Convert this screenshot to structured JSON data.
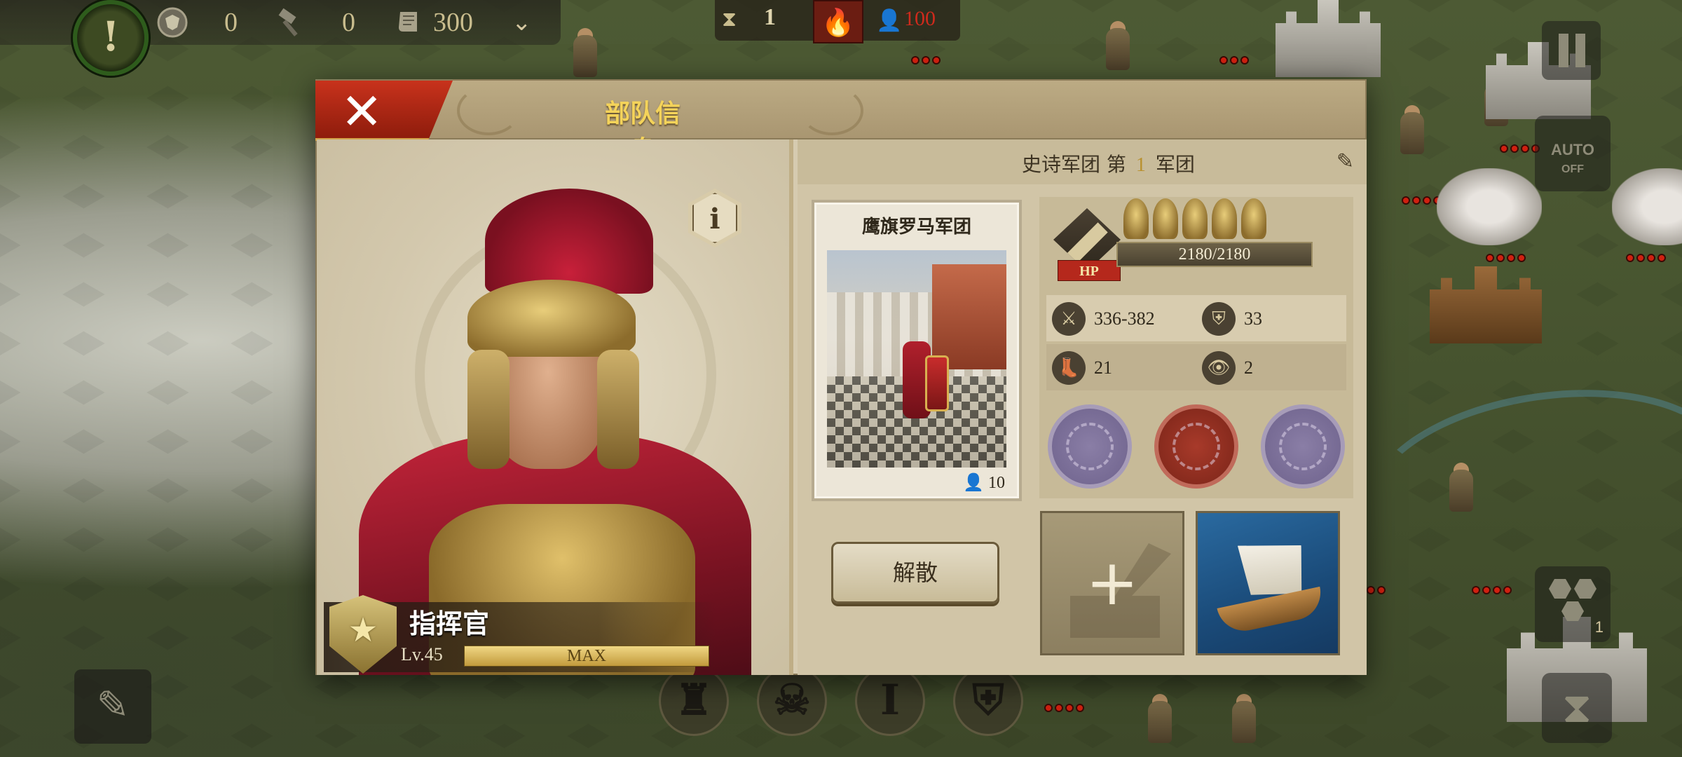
{
  "hud": {
    "alert_icon": "!",
    "resources": [
      {
        "icon": "shield-coin-icon",
        "value": "0"
      },
      {
        "icon": "hammer-icon",
        "value": "0"
      },
      {
        "icon": "scroll-icon",
        "value": "300"
      }
    ],
    "turn": "1",
    "population": "100"
  },
  "right_controls": {
    "auto_label": "AUTO",
    "auto_state": "OFF",
    "hex_count": "1"
  },
  "dialog": {
    "title": "部队信息",
    "commander": {
      "name": "指挥官",
      "level": "Lv.45",
      "level_bar": "MAX"
    },
    "legion": {
      "prefix": "史诗军团 第",
      "number": "1",
      "suffix": "军团"
    },
    "unit": {
      "name": "鹰旗罗马军团",
      "count": "10"
    },
    "stats": {
      "hp_tag": "HP",
      "hp": "2180/2180",
      "attack": "336-382",
      "defense": "33",
      "movement": "21",
      "vision": "2",
      "star_helmets": 5
    },
    "disband_label": "解散"
  },
  "colors": {
    "title_gold": "#f4d35a",
    "close_red": "#c8321c",
    "hp_red": "#b5281c",
    "population_red": "#cf2a1c"
  }
}
